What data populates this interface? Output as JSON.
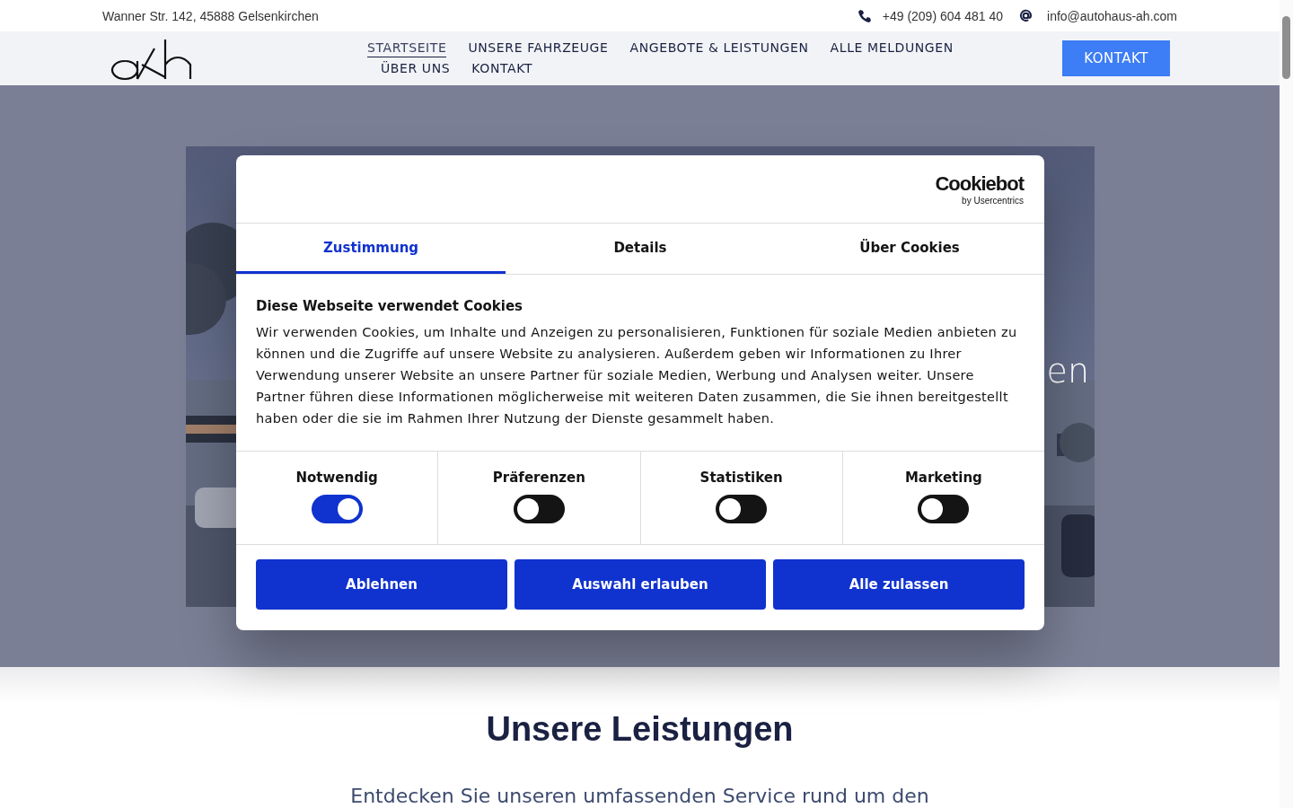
{
  "topbar": {
    "address": "Wanner Str. 142, 45888 Gelsenkirchen",
    "phone": "+49 (209) 604 481 40",
    "email": "info@autohaus-ah.com"
  },
  "nav": {
    "items": [
      {
        "label": "STARTSEITE",
        "selected": true
      },
      {
        "label": "UNSERE FAHRZEUGE",
        "selected": false
      },
      {
        "label": "ANGEBOTE & LEISTUNGEN",
        "selected": false
      },
      {
        "label": "ALLE MELDUNGEN",
        "selected": false
      },
      {
        "label": "ÜBER UNS",
        "selected": false
      },
      {
        "label": "KONTAKT",
        "selected": false
      }
    ],
    "button": "KONTAKT"
  },
  "hero": {
    "heading_fragment": "en"
  },
  "cookie_dialog": {
    "brand": "Cookiebot",
    "brand_sub": "by Usercentrics",
    "tabs": [
      {
        "label": "Zustimmung",
        "selected": true
      },
      {
        "label": "Details",
        "selected": false
      },
      {
        "label": "Über Cookies",
        "selected": false
      }
    ],
    "title": "Diese Webseite verwendet Cookies",
    "body": "Wir verwenden Cookies, um Inhalte und Anzeigen zu personalisieren, Funktionen für soziale Medien anbieten zu können und die Zugriffe auf unsere Website zu analysieren. Außerdem geben wir Informationen zu Ihrer Verwendung unserer Website an unsere Partner für soziale Medien, Werbung und Analysen weiter. Unsere Partner führen diese Informationen möglicherweise mit weiteren Daten zusammen, die Sie ihnen bereitgestellt haben oder die sie im Rahmen Ihrer Nutzung der Dienste gesammelt haben.",
    "categories": [
      {
        "label": "Notwendig",
        "on": true
      },
      {
        "label": "Präferenzen",
        "on": false
      },
      {
        "label": "Statistiken",
        "on": false
      },
      {
        "label": "Marketing",
        "on": false
      }
    ],
    "buttons": [
      "Ablehnen",
      "Auswahl erlauben",
      "Alle zulassen"
    ]
  },
  "services": {
    "heading": "Unsere Leistungen",
    "subtitle": "Entdecken Sie unseren umfassenden Service rund um den"
  }
}
